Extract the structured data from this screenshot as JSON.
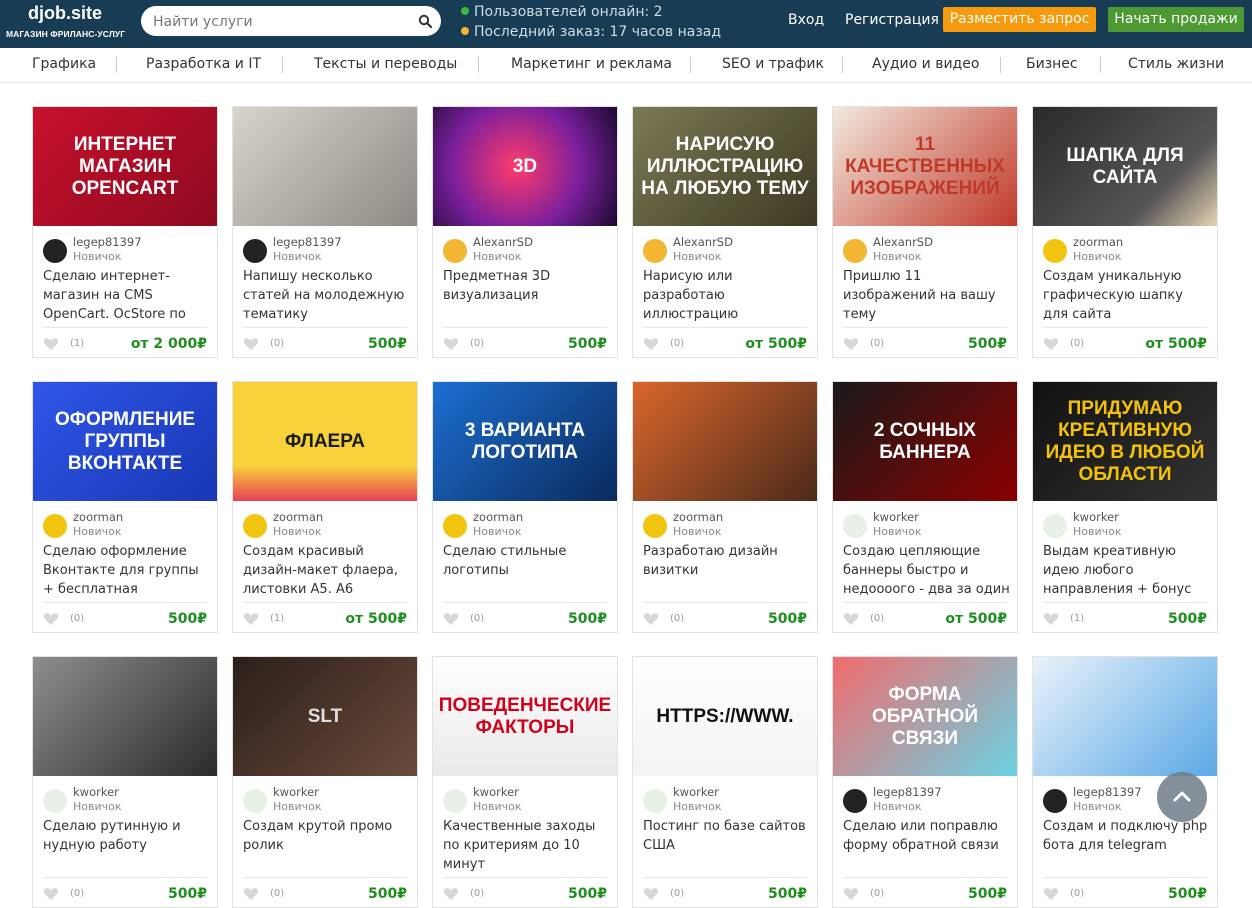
{
  "header": {
    "logo_main": "djob.site",
    "logo_sub": "МАГАЗИН ФРИЛАНС-УСЛУГ",
    "search_placeholder": "Найти услуги",
    "online_text": "Пользователей онлайн: 2",
    "last_order_text": "Последний заказ: 17 часов назад",
    "login_label": "Вход",
    "register_label": "Регистрация",
    "post_request_label": "Разместить запрос",
    "start_selling_label": "Начать продажи",
    "colors": {
      "bg": "#173c54",
      "orange": "#f59a0c",
      "green": "#4d9a33",
      "online_dot": "#3dbb3d",
      "order_dot": "#f3b431"
    }
  },
  "nav": {
    "items": [
      "Графика",
      "Разработка и IT",
      "Тексты и переводы",
      "Маркетинг и реклама",
      "SEO и трафик",
      "Аудио и видео",
      "Бизнес",
      "Стиль жизни"
    ]
  },
  "cards": [
    {
      "thumb_text": "Интернет магазин OpenCart",
      "author": "legep81397",
      "level": "Новичок",
      "title": "Сделаю интернет-магазин на CMS OpenCart. OcStore по",
      "likes": "(1)",
      "price": "от 2 000₽"
    },
    {
      "thumb_text": "",
      "author": "legep81397",
      "level": "Новичок",
      "title": "Напишу несколько статей на молодежную тематику",
      "likes": "(0)",
      "price": "500₽"
    },
    {
      "thumb_text": "3D",
      "author": "AlexanrSD",
      "level": "Новичок",
      "title": "Предметная 3D визуализация",
      "likes": "(0)",
      "price": "500₽"
    },
    {
      "thumb_text": "Нарисую иллюстрацию на любую тему",
      "author": "AlexanrSD",
      "level": "Новичок",
      "title": "Нарисую или разработаю иллюстрацию",
      "likes": "(0)",
      "price": "от 500₽"
    },
    {
      "thumb_text": "11 качественных изображений",
      "author": "AlexanrSD",
      "level": "Новичок",
      "title": "Пришлю 11 изображений на вашу тему",
      "likes": "(0)",
      "price": "500₽"
    },
    {
      "thumb_text": "Шапка для сайта",
      "author": "zoorman",
      "level": "Новичок",
      "title": "Создам уникальную графическую шапку для сайта",
      "likes": "(0)",
      "price": "от 500₽"
    },
    {
      "thumb_text": "Оформление группы Вконтакте",
      "author": "zoorman",
      "level": "Новичок",
      "title": "Сделаю оформление Вконтакте для группы + бесплатная установка",
      "likes": "(0)",
      "price": "500₽"
    },
    {
      "thumb_text": "Флаера",
      "author": "zoorman",
      "level": "Новичок",
      "title": "Создам красивый дизайн-макет флаера, листовки А5. А6",
      "likes": "(1)",
      "price": "от 500₽"
    },
    {
      "thumb_text": "3 варианта логотипа",
      "author": "zoorman",
      "level": "Новичок",
      "title": "Сделаю стильные логотипы",
      "likes": "(0)",
      "price": "500₽"
    },
    {
      "thumb_text": "",
      "author": "zoorman",
      "level": "Новичок",
      "title": "Разработаю дизайн визитки",
      "likes": "(0)",
      "price": "500₽"
    },
    {
      "thumb_text": "2 сочных баннера",
      "author": "kworker",
      "level": "Новичок",
      "title": "Создаю цепляющие баннеры быстро и недоооого - два за один",
      "likes": "(0)",
      "price": "от 500₽"
    },
    {
      "thumb_text": "Придумаю креативную идею в любой области",
      "author": "kworker",
      "level": "Новичок",
      "title": "Выдам креативную идею любого направления + бонус",
      "likes": "(1)",
      "price": "500₽"
    },
    {
      "thumb_text": "",
      "author": "kworker",
      "level": "Новичок",
      "title": "Сделаю рутинную и нудную работу",
      "likes": "(0)",
      "price": "500₽"
    },
    {
      "thumb_text": "SLT",
      "author": "kworker",
      "level": "Новичок",
      "title": "Создам крутой промо ролик",
      "likes": "(0)",
      "price": "500₽"
    },
    {
      "thumb_text": "Поведенческие факторы",
      "author": "kworker",
      "level": "Новичок",
      "title": "Качественные заходы по критериям до 10 минут",
      "likes": "(0)",
      "price": "500₽"
    },
    {
      "thumb_text": "https://www.",
      "author": "kworker",
      "level": "Новичок",
      "title": "Постинг по базе сайтов США",
      "likes": "(0)",
      "price": "500₽"
    },
    {
      "thumb_text": "Форма обратной связи",
      "author": "legep81397",
      "level": "Новичок",
      "title": "Сделаю или поправлю форму обратной связи",
      "likes": "(0)",
      "price": "500₽"
    },
    {
      "thumb_text": "",
      "author": "legep81397",
      "level": "Новичок",
      "title": "Создам и подключу php бота для telegram",
      "likes": "(0)",
      "price": "500₽"
    }
  ]
}
